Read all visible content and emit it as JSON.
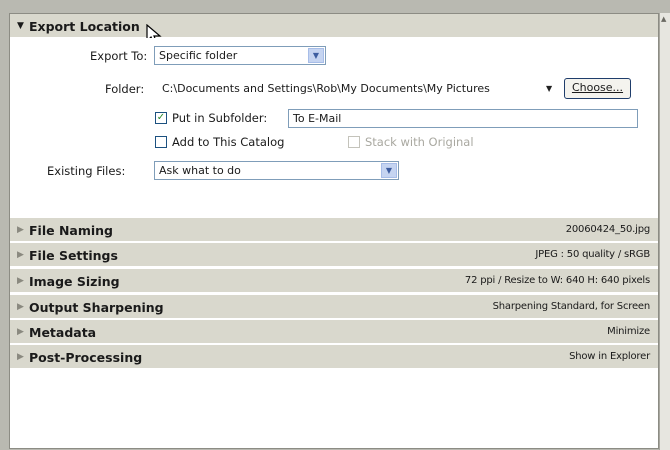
{
  "sections": {
    "export_location": {
      "title": "Export Location",
      "export_to_label": "Export To:",
      "export_to_value": "Specific folder",
      "folder_label": "Folder:",
      "folder_path": "C:\\Documents and Settings\\Rob\\My Documents\\My Pictures",
      "choose_button": "Choose...",
      "put_in_subfolder_label": "Put in Subfolder:",
      "put_in_subfolder_checked": true,
      "subfolder_value": "To E-Mail",
      "add_to_catalog_label": "Add to This Catalog",
      "add_to_catalog_checked": false,
      "stack_with_original_label": "Stack with Original",
      "stack_with_original_checked": false,
      "existing_files_label": "Existing Files:",
      "existing_files_value": "Ask what to do"
    },
    "collapsed": [
      {
        "title": "File Naming",
        "summary": "20060424_50.jpg"
      },
      {
        "title": "File Settings",
        "summary": "JPEG : 50 quality / sRGB"
      },
      {
        "title": "Image Sizing",
        "summary": "72 ppi / Resize to W: 640 H: 640 pixels"
      },
      {
        "title": "Output Sharpening",
        "summary": "Sharpening Standard, for Screen"
      },
      {
        "title": "Metadata",
        "summary": "Minimize"
      },
      {
        "title": "Post-Processing",
        "summary": "Show in Explorer"
      }
    ]
  },
  "colors": {
    "section_bg": "#d9d8cd",
    "panel_bg": "#ffffff",
    "input_border": "#7f9db9"
  },
  "icons": {
    "expanded": "triangle-down-icon",
    "collapsed": "triangle-right-icon",
    "dropdown": "chevron-down-icon",
    "checkmark": "check-icon",
    "cursor": "mouse-pointer-icon"
  }
}
